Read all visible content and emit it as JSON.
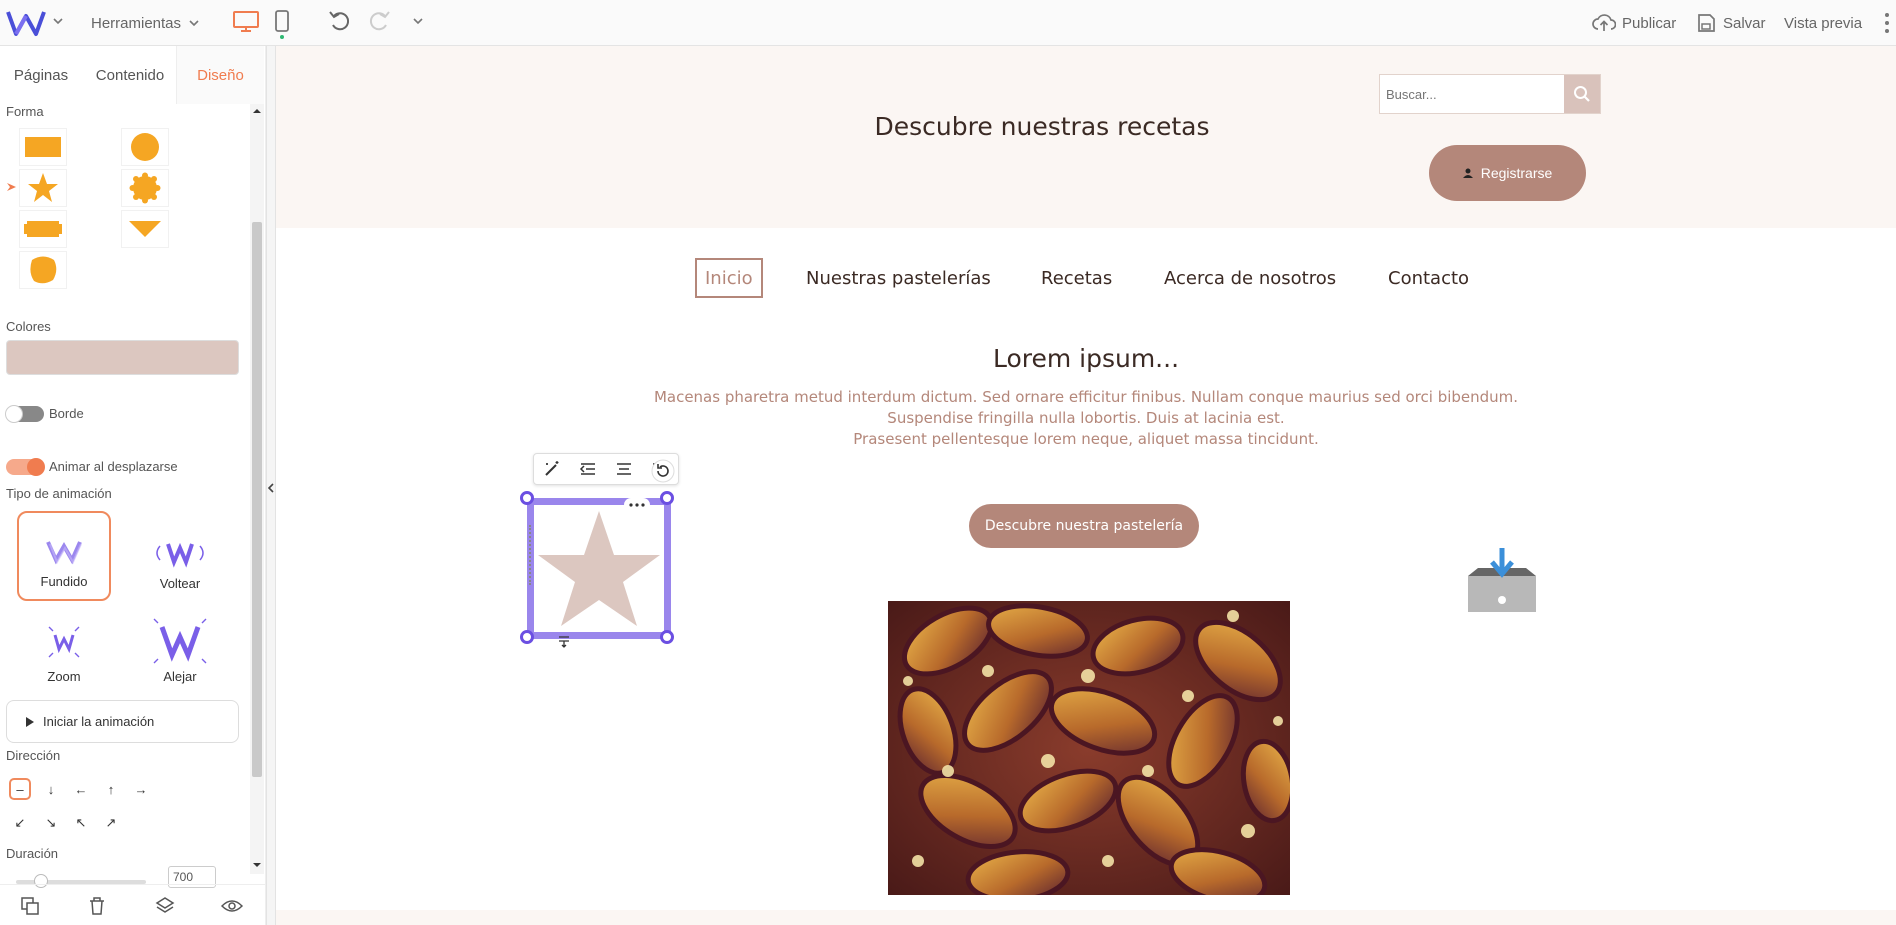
{
  "topbar": {
    "tools_label": "Herramientas",
    "publish_label": "Publicar",
    "save_label": "Salvar",
    "preview_label": "Vista previa"
  },
  "panel": {
    "tabs": [
      {
        "label": "Páginas"
      },
      {
        "label": "Contenido"
      },
      {
        "label": "Diseño"
      }
    ],
    "shape_label": "Forma",
    "colors_label": "Colores",
    "selected_color": "#dcc7c0",
    "border_label": "Borde",
    "animate_label": "Animar al desplazarse",
    "animation_type_label": "Tipo de animación",
    "animations": [
      {
        "label": "Fundido"
      },
      {
        "label": "Voltear"
      },
      {
        "label": "Zoom"
      },
      {
        "label": "Alejar"
      }
    ],
    "start_animation_label": "Iniciar la animación",
    "direction_label": "Dirección",
    "duration_label": "Duración",
    "duration_value": "700"
  },
  "site": {
    "search_placeholder": "Buscar...",
    "title": "Descubre nuestras recetas",
    "register_label": "Registrarse",
    "nav": [
      {
        "label": "Inicio"
      },
      {
        "label": "Nuestras pastelerías"
      },
      {
        "label": "Recetas"
      },
      {
        "label": "Acerca de nosotros"
      },
      {
        "label": "Contacto"
      }
    ],
    "lorem_title": "Lorem ipsum...",
    "lorem_lines": [
      "Macenas pharetra metud interdum dictum. Sed ornare efficitur finibus. Nullam conque maurius sed orci bibendum.",
      "Suspendise fringilla nulla lobortis. Duis at lacinia est.",
      "Prasesent pellentesque lorem neque, aliquet massa tincidunt."
    ],
    "cta_label": "Descubre nuestra pastelería"
  },
  "colors": {
    "accent": "#f07c4f",
    "brand": "#b4877a",
    "shape_fill": "#f5a623",
    "selection": "#9a86ec"
  }
}
